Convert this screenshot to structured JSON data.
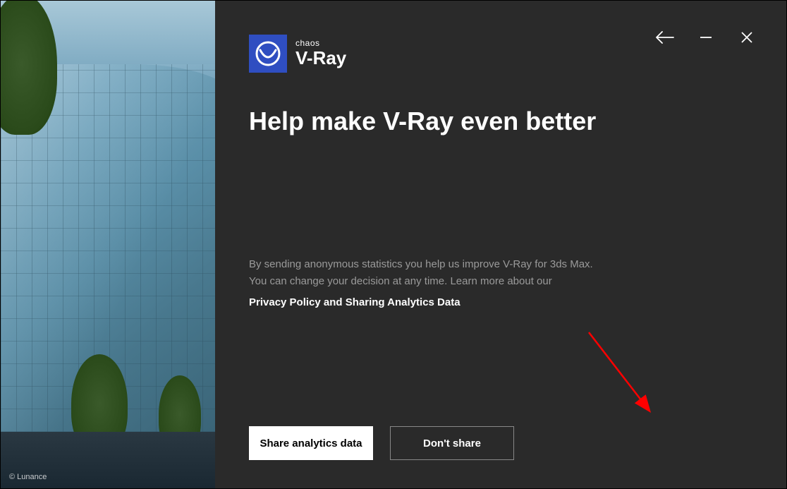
{
  "logo": {
    "brand": "chaos",
    "product": "V-Ray"
  },
  "heading": "Help make V-Ray even better",
  "body": {
    "line1": "By sending anonymous statistics you help us improve V-Ray for 3ds Max.",
    "line2": "You can change your decision at any time. Learn more about our",
    "link": "Privacy Policy and Sharing Analytics Data"
  },
  "buttons": {
    "primary": "Share analytics data",
    "secondary": "Don't share"
  },
  "credit": "© Lunance"
}
